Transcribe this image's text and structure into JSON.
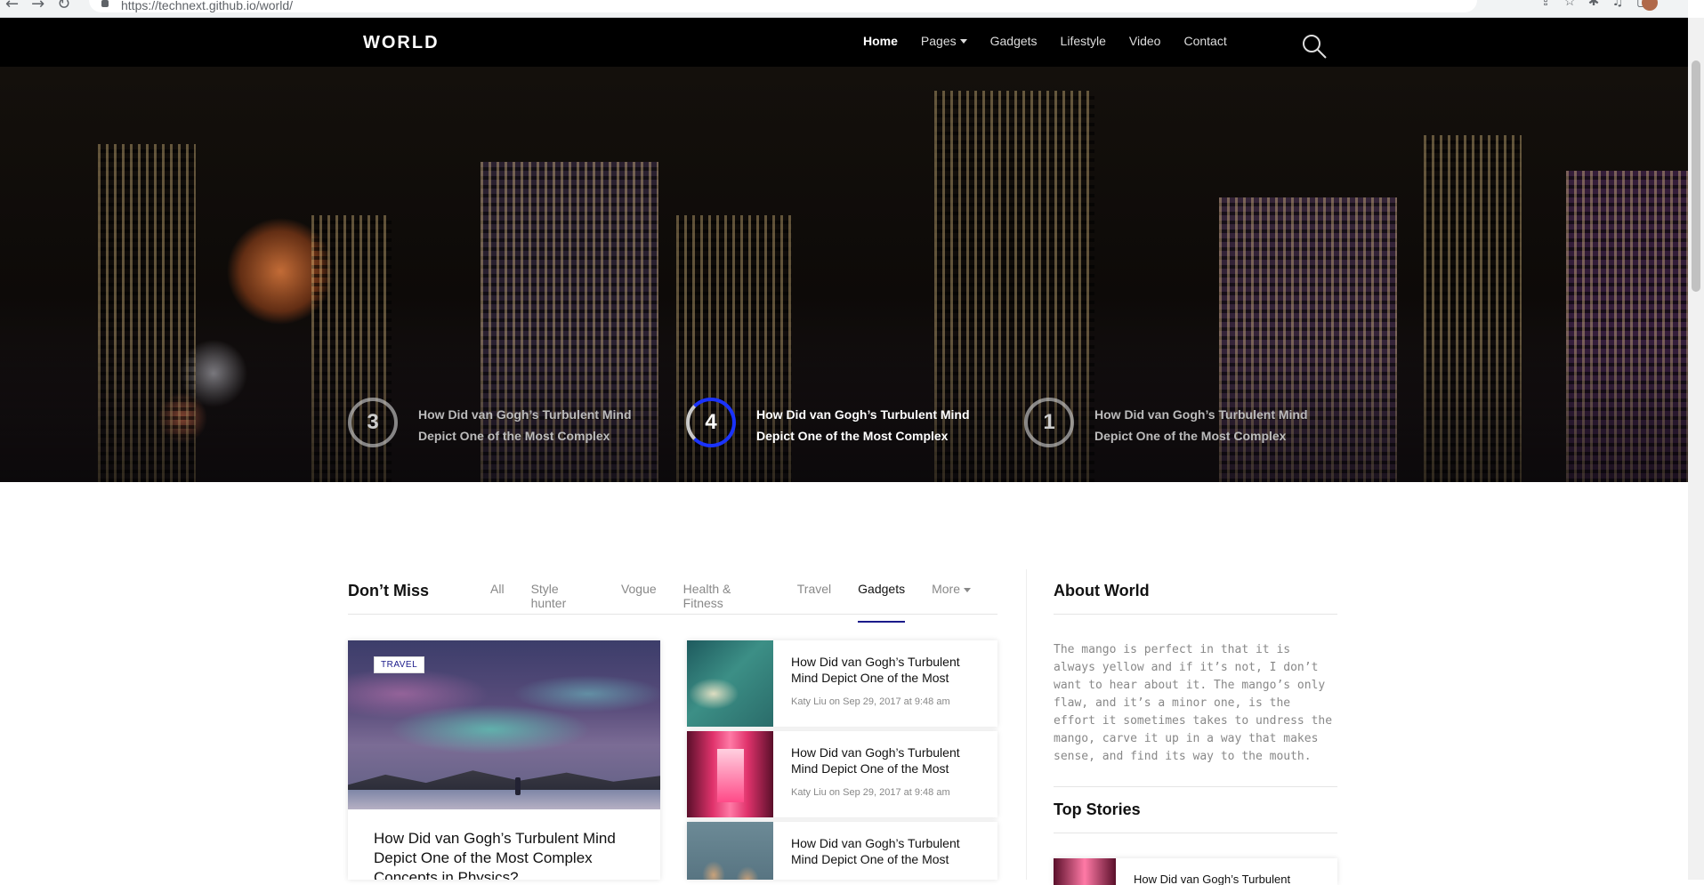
{
  "browser": {
    "url": "https://technext.github.io/world/"
  },
  "header": {
    "logo": "WORLD",
    "nav": [
      {
        "label": "Home"
      },
      {
        "label": "Pages"
      },
      {
        "label": "Gadgets"
      },
      {
        "label": "Lifestyle"
      },
      {
        "label": "Video"
      },
      {
        "label": "Contact"
      }
    ],
    "search_icon": "search-icon"
  },
  "hero": {
    "items": [
      {
        "number": "3",
        "title": "How Did van Gogh’s Turbulent Mind Depict One of the Most Complex"
      },
      {
        "number": "4",
        "title": "How Did van Gogh’s Turbulent Mind Depict One of the Most Complex"
      },
      {
        "number": "1",
        "title": "How Did van Gogh’s Turbulent Mind Depict One of the Most Complex"
      }
    ]
  },
  "dont_miss": {
    "title": "Don’t Miss",
    "tabs": [
      "All",
      "Style hunter",
      "Vogue",
      "Health & Fitness",
      "Travel",
      "Gadgets",
      "More"
    ],
    "active_tab": "Gadgets",
    "featured": {
      "tag": "TRAVEL",
      "title": "How Did van Gogh’s Turbulent Mind Depict One of the Most Complex Concepts in Physics?"
    },
    "list": [
      {
        "title": "How Did van Gogh’s Turbulent Mind Depict One of the Most",
        "author": "Katy Liu",
        "on": "on",
        "date": "Sep 29, 2017 at 9:48 am"
      },
      {
        "title": "How Did van Gogh’s Turbulent Mind Depict One of the Most",
        "author": "Katy Liu",
        "on": "on",
        "date": "Sep 29, 2017 at 9:48 am"
      },
      {
        "title": "How Did van Gogh’s Turbulent Mind Depict One of the Most",
        "author": "",
        "on": "",
        "date": ""
      }
    ]
  },
  "sidebar": {
    "about_title": "About World",
    "about_text": "The mango is perfect in that it is always yellow and if it’s not, I don’t want to hear about it. The mango’s only flaw, and it’s a minor one, is the effort it sometimes takes to undress the mango, carve it up in a way that makes sense, and find its way to the mouth.",
    "top_stories_title": "Top Stories",
    "top_story_title": "How Did van Gogh’s Turbulent"
  },
  "colors": {
    "accent": "#1a33ff",
    "tab_underline": "#1a1a8a",
    "header_bg": "#000000"
  }
}
